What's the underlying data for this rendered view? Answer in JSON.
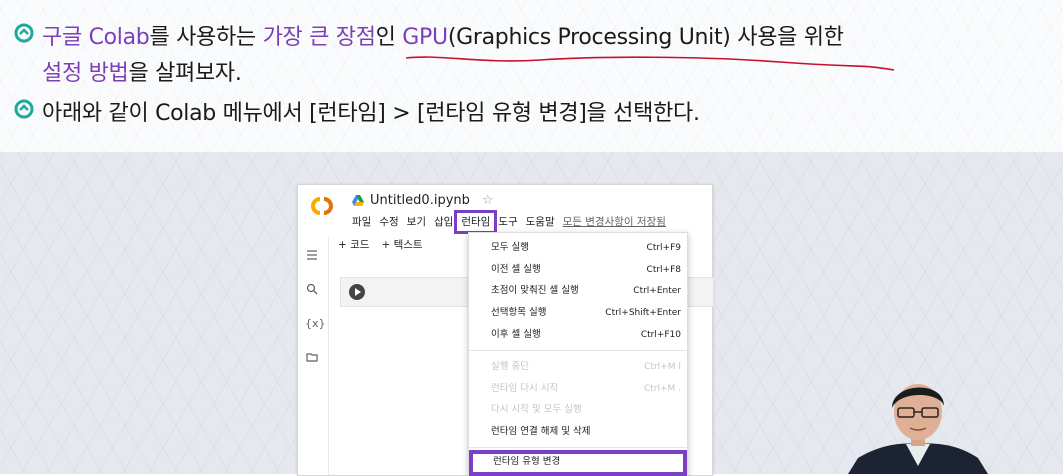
{
  "slide": {
    "line1": {
      "pre": "구글 Colab",
      "a": "를 사용하는 ",
      "b": "가장 큰 장점",
      "c": "인 ",
      "d": "GPU",
      "e": "(Graphics Processing Unit) 사용을 위한"
    },
    "line2": {
      "a": "설정 방법",
      "b": "을 살펴보자."
    },
    "line3": "아래와 같이 Colab 메뉴에서 [런타임] > [런타임 유형 변경]을 선택한다."
  },
  "colab": {
    "title": "Untitled0.ipynb",
    "menu": [
      "파일",
      "수정",
      "보기",
      "삽입",
      "런타임",
      "도구",
      "도움말"
    ],
    "saved": "모든 변경사항이 저장됨",
    "add_code": "+ 코드",
    "add_text": "+ 텍스트",
    "side_var": "{x}"
  },
  "dropdown": [
    {
      "label": "모두 실행",
      "shortcut": "Ctrl+F9",
      "disabled": false
    },
    {
      "label": "이전 셀 실행",
      "shortcut": "Ctrl+F8",
      "disabled": false
    },
    {
      "label": "초점이 맞춰진 셀 실행",
      "shortcut": "Ctrl+Enter",
      "disabled": false
    },
    {
      "label": "선택항목 실행",
      "shortcut": "Ctrl+Shift+Enter",
      "disabled": false
    },
    {
      "label": "이후 셀 실행",
      "shortcut": "Ctrl+F10",
      "disabled": false
    },
    {
      "label": "실행 중단",
      "shortcut": "Ctrl+M I",
      "disabled": true
    },
    {
      "label": "런타임 다시 시작",
      "shortcut": "Ctrl+M .",
      "disabled": true
    },
    {
      "label": "다시 시작 및 모두 실행",
      "shortcut": "",
      "disabled": true
    },
    {
      "label": "런타임 연결 해제 및 삭제",
      "shortcut": "",
      "disabled": false
    },
    {
      "label": "런타임 유형 변경",
      "shortcut": "",
      "disabled": false
    }
  ],
  "colors": {
    "accent": "#7d3fb8",
    "highlight": "#7b3fc6",
    "bullet": "#1ea99a",
    "pen": "#c8102e"
  }
}
